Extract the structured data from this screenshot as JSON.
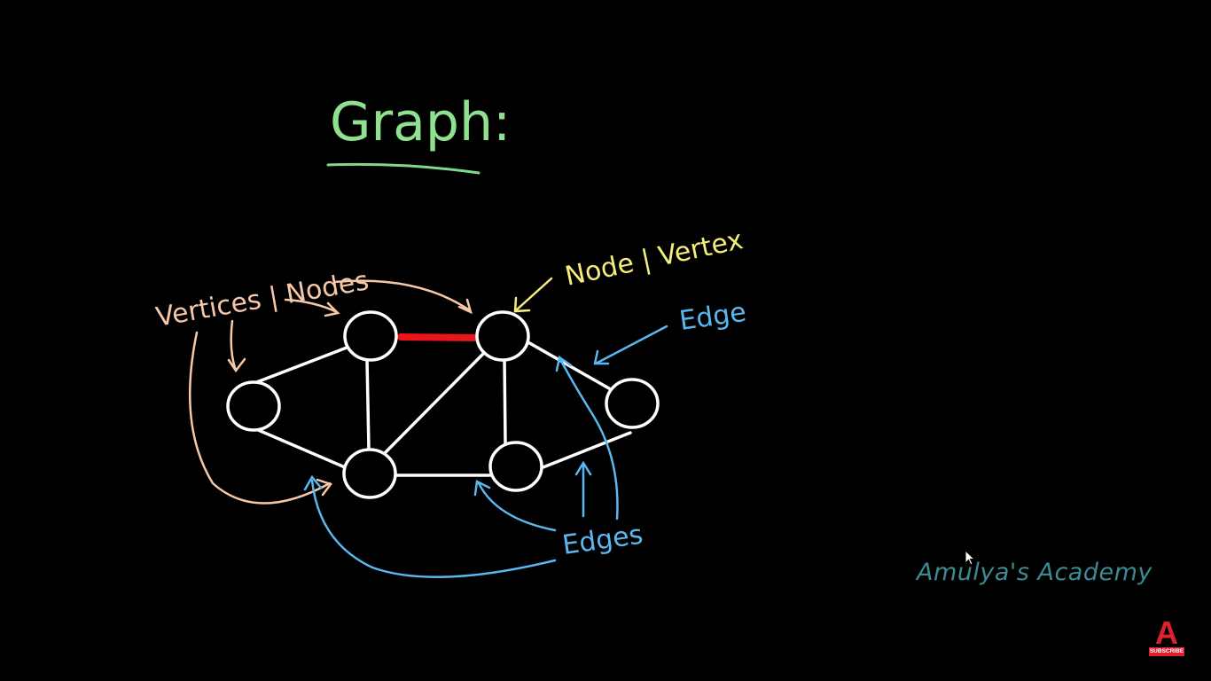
{
  "title": "Graph:",
  "labels": {
    "vertices_nodes": "Vertices | Nodes",
    "node_vertex": "Node | Vertex",
    "edge": "Edge",
    "edges": "Edges"
  },
  "watermark": "Amulya's Academy",
  "subscribe": {
    "letter": "A",
    "text": "SUBSCRIBE"
  },
  "colors": {
    "background": "#000000",
    "title": "#8fe08f",
    "title_underline": "#7fd98a",
    "graph": "#ffffff",
    "highlight_edge": "#e8151b",
    "vertices_label": "#f6c8a8",
    "node_label": "#f6ee7a",
    "edge_label": "#5bb7f0",
    "watermark": "#3c8a93",
    "badge": "#e0202c"
  },
  "icons": {
    "cursor": "mouse-pointer-icon",
    "badge": "subscribe-badge-icon"
  }
}
